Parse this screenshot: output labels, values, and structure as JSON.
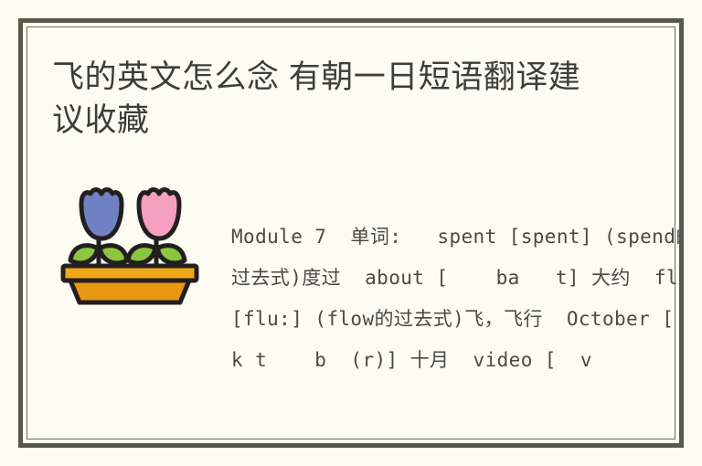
{
  "page": {
    "background_color": "#fdfcf3",
    "frame_color": "#585849",
    "text_color": "#4a4a42"
  },
  "article": {
    "title": "飞的英文怎么念 有朝一日短语翻译建议收藏",
    "body": "Module 7  单词:   spent [spent] (spend的过去式)度过  about [    ba   t] 大约  flew [flu:] (flow的过去式)飞，飞行  October [  k t    b  (r)] 十月  video [  v"
  },
  "illustration": {
    "name": "flower-box-clipart",
    "outline_color": "#231f20",
    "planter_color": "#e89711",
    "planter_rim_color": "#f0a818",
    "leaf_color": "#8cc63f",
    "stem_color": "#8cc63f",
    "flowers": [
      {
        "name": "blue-tulip",
        "color": "#7082c4"
      },
      {
        "name": "pink-tulip",
        "color": "#f5a0be"
      }
    ]
  }
}
